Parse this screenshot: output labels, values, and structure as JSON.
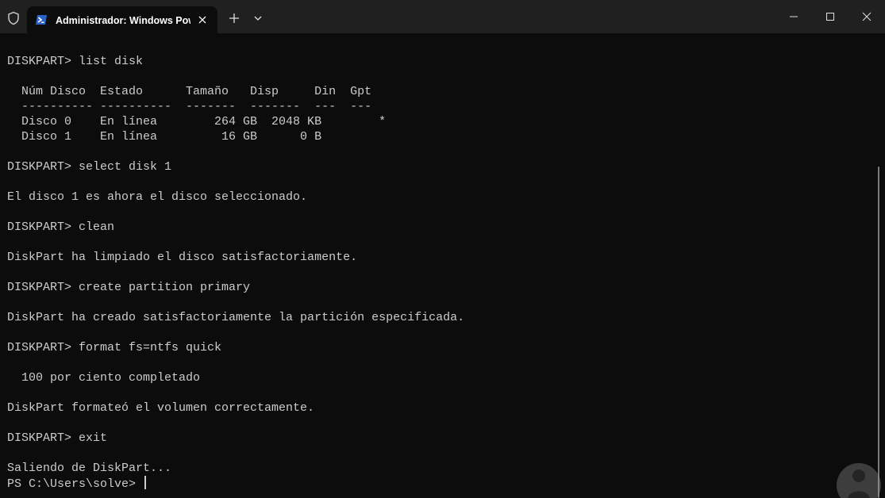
{
  "window": {
    "tab_title": "Administrador: Windows Pow"
  },
  "icons": {
    "shield": "shield-icon",
    "powershell": "powershell-icon",
    "tab_close": "close-icon",
    "new_tab": "plus-icon",
    "dropdown": "chevron-down-icon",
    "minimize": "minimize-icon",
    "maximize": "maximize-icon",
    "close": "close-icon",
    "watermark": "person-logo-icon"
  },
  "colors": {
    "terminal_bg": "#0c0c0c",
    "titlebar_bg": "#202020",
    "text": "#cccccc",
    "powershell_blue": "#2a64c8"
  },
  "terminal": {
    "lines": [
      "DISKPART> list disk",
      "",
      "  Núm Disco  Estado      Tamaño   Disp     Din  Gpt",
      "  ---------- ----------  -------  -------  ---  ---",
      "  Disco 0    En línea        264 GB  2048 KB        *",
      "  Disco 1    En línea         16 GB      0 B",
      "",
      "DISKPART> select disk 1",
      "",
      "El disco 1 es ahora el disco seleccionado.",
      "",
      "DISKPART> clean",
      "",
      "DiskPart ha limpiado el disco satisfactoriamente.",
      "",
      "DISKPART> create partition primary",
      "",
      "DiskPart ha creado satisfactoriamente la partición especificada.",
      "",
      "DISKPART> format fs=ntfs quick",
      "",
      "  100 por ciento completado",
      "",
      "DiskPart formateó el volumen correctamente.",
      "",
      "DISKPART> exit",
      "",
      "Saliendo de DiskPart...",
      "PS C:\\Users\\solve> "
    ]
  }
}
